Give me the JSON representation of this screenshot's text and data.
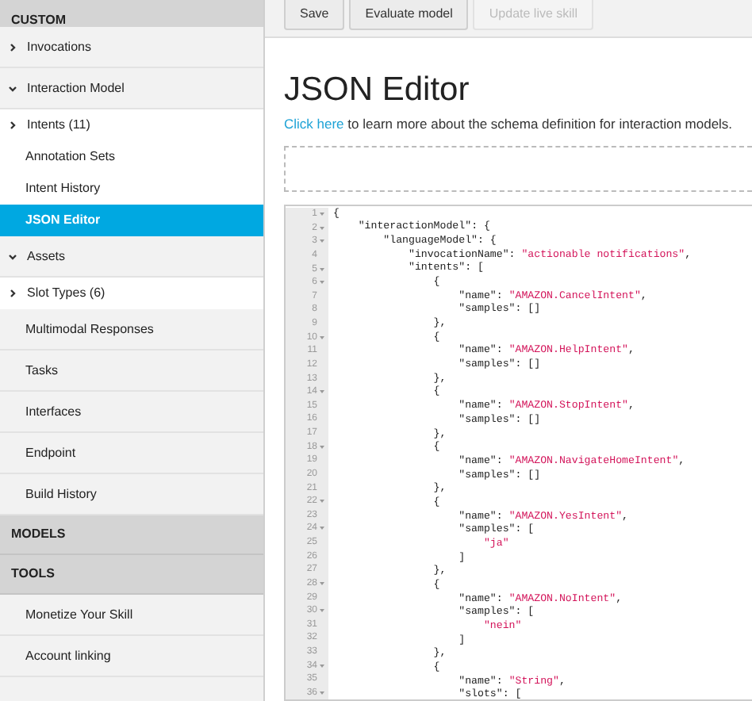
{
  "sidebar": {
    "items": [
      {
        "kind": "header",
        "label": "CUSTOM"
      },
      {
        "kind": "group",
        "label": "Invocations",
        "expanded": false
      },
      {
        "kind": "group",
        "label": "Interaction Model",
        "expanded": true
      },
      {
        "kind": "child",
        "label": "Intents (11)",
        "expanded": false,
        "selected": false
      },
      {
        "kind": "child",
        "label": "Annotation Sets",
        "selected": false
      },
      {
        "kind": "child",
        "label": "Intent History",
        "selected": false
      },
      {
        "kind": "child",
        "label": "JSON Editor",
        "selected": true
      },
      {
        "kind": "group",
        "label": "Assets",
        "expanded": true
      },
      {
        "kind": "child",
        "label": "Slot Types (6)",
        "expanded": false,
        "selected": false
      },
      {
        "kind": "page",
        "label": "Multimodal Responses"
      },
      {
        "kind": "page",
        "label": "Tasks"
      },
      {
        "kind": "page",
        "label": "Interfaces"
      },
      {
        "kind": "page",
        "label": "Endpoint"
      },
      {
        "kind": "page",
        "label": "Build History"
      },
      {
        "kind": "header",
        "label": "MODELS"
      },
      {
        "kind": "header",
        "label": "TOOLS"
      },
      {
        "kind": "page",
        "label": "Monetize Your Skill"
      },
      {
        "kind": "page",
        "label": "Account linking"
      }
    ]
  },
  "toolbar": {
    "buttons": [
      {
        "label": "Save",
        "disabled": false
      },
      {
        "label": "Evaluate model",
        "disabled": false
      },
      {
        "label": "Update live skill",
        "disabled": true
      }
    ]
  },
  "title": "JSON Editor",
  "help": {
    "link": "Click here",
    "text": " to learn more about the schema definition for interaction models."
  },
  "editor": {
    "lines": [
      {
        "number": "1",
        "fold": true,
        "text": "{"
      },
      {
        "number": "2",
        "fold": true,
        "text": "    \"interactionModel\": {"
      },
      {
        "number": "3",
        "fold": true,
        "text": "        \"languageModel\": {"
      },
      {
        "number": "4",
        "fold": false,
        "text": "            \"invocationName\": \"actionable notifications\","
      },
      {
        "number": "5",
        "fold": true,
        "text": "            \"intents\": ["
      },
      {
        "number": "6",
        "fold": true,
        "text": "                {"
      },
      {
        "number": "7",
        "fold": false,
        "text": "                    \"name\": \"AMAZON.CancelIntent\","
      },
      {
        "number": "8",
        "fold": false,
        "text": "                    \"samples\": []"
      },
      {
        "number": "9",
        "fold": false,
        "text": "                },"
      },
      {
        "number": "10",
        "fold": true,
        "text": "                {"
      },
      {
        "number": "11",
        "fold": false,
        "text": "                    \"name\": \"AMAZON.HelpIntent\","
      },
      {
        "number": "12",
        "fold": false,
        "text": "                    \"samples\": []"
      },
      {
        "number": "13",
        "fold": false,
        "text": "                },"
      },
      {
        "number": "14",
        "fold": true,
        "text": "                {"
      },
      {
        "number": "15",
        "fold": false,
        "text": "                    \"name\": \"AMAZON.StopIntent\","
      },
      {
        "number": "16",
        "fold": false,
        "text": "                    \"samples\": []"
      },
      {
        "number": "17",
        "fold": false,
        "text": "                },"
      },
      {
        "number": "18",
        "fold": true,
        "text": "                {"
      },
      {
        "number": "19",
        "fold": false,
        "text": "                    \"name\": \"AMAZON.NavigateHomeIntent\","
      },
      {
        "number": "20",
        "fold": false,
        "text": "                    \"samples\": []"
      },
      {
        "number": "21",
        "fold": false,
        "text": "                },"
      },
      {
        "number": "22",
        "fold": true,
        "text": "                {"
      },
      {
        "number": "23",
        "fold": false,
        "text": "                    \"name\": \"AMAZON.YesIntent\","
      },
      {
        "number": "24",
        "fold": true,
        "text": "                    \"samples\": ["
      },
      {
        "number": "25",
        "fold": false,
        "text": "                        \"ja\""
      },
      {
        "number": "26",
        "fold": false,
        "text": "                    ]"
      },
      {
        "number": "27",
        "fold": false,
        "text": "                },"
      },
      {
        "number": "28",
        "fold": true,
        "text": "                {"
      },
      {
        "number": "29",
        "fold": false,
        "text": "                    \"name\": \"AMAZON.NoIntent\","
      },
      {
        "number": "30",
        "fold": true,
        "text": "                    \"samples\": ["
      },
      {
        "number": "31",
        "fold": false,
        "text": "                        \"nein\""
      },
      {
        "number": "32",
        "fold": false,
        "text": "                    ]"
      },
      {
        "number": "33",
        "fold": false,
        "text": "                },"
      },
      {
        "number": "34",
        "fold": true,
        "text": "                {"
      },
      {
        "number": "35",
        "fold": false,
        "text": "                    \"name\": \"String\","
      },
      {
        "number": "36",
        "fold": true,
        "text": "                    \"slots\": ["
      }
    ]
  }
}
